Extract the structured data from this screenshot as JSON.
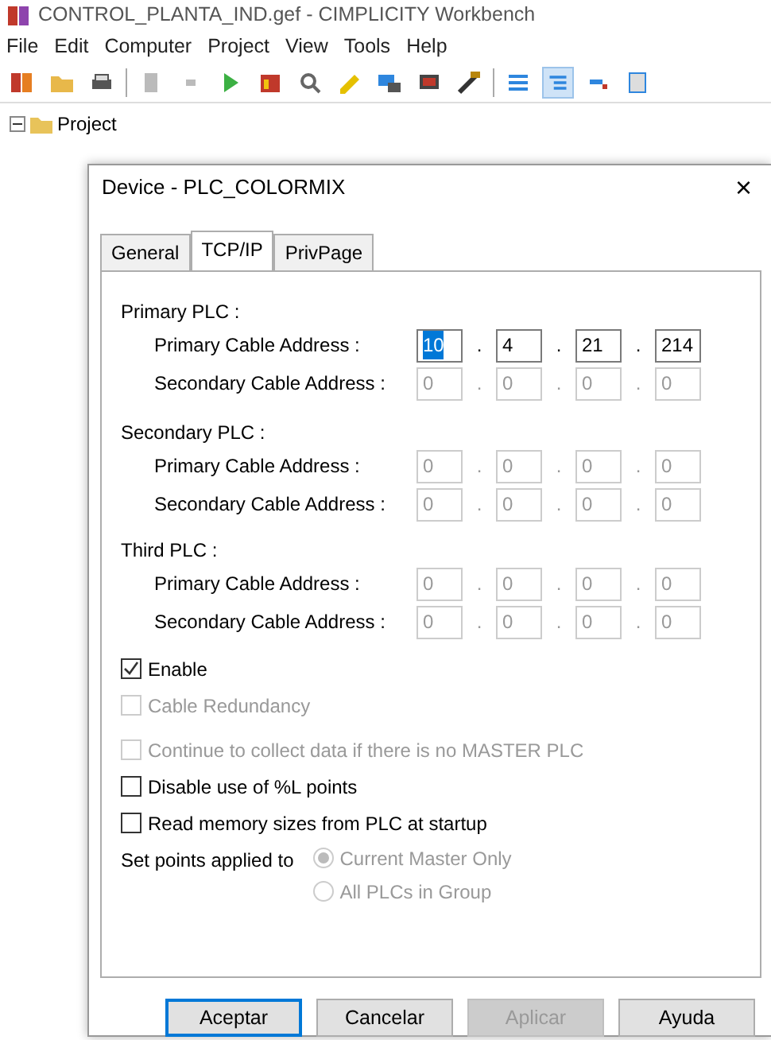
{
  "window": {
    "title": "CONTROL_PLANTA_IND.gef - CIMPLICITY Workbench"
  },
  "menu": [
    "File",
    "Edit",
    "Computer",
    "Project",
    "View",
    "Tools",
    "Help"
  ],
  "tree": {
    "label": "Project",
    "expanded": true
  },
  "dialog": {
    "title": "Device - PLC_COLORMIX",
    "close": "×",
    "separator": ".",
    "tabs": [
      {
        "label": "General",
        "selected": false
      },
      {
        "label": "TCP/IP",
        "selected": true
      },
      {
        "label": "PrivPage",
        "selected": false
      }
    ],
    "groups": [
      {
        "label": "Primary PLC :",
        "rows": [
          {
            "label": "Primary Cable Address :",
            "disabled": false,
            "octets": [
              {
                "value": "10",
                "selected": true
              },
              {
                "value": "4",
                "selected": false
              },
              {
                "value": "21",
                "selected": false
              },
              {
                "value": "214",
                "selected": false
              }
            ]
          },
          {
            "label": "Secondary Cable Address :",
            "disabled": true,
            "octets": [
              {
                "value": "0",
                "selected": false
              },
              {
                "value": "0",
                "selected": false
              },
              {
                "value": "0",
                "selected": false
              },
              {
                "value": "0",
                "selected": false
              }
            ]
          }
        ]
      },
      {
        "label": "Secondary PLC :",
        "rows": [
          {
            "label": "Primary Cable Address :",
            "disabled": true,
            "octets": [
              {
                "value": "0",
                "selected": false
              },
              {
                "value": "0",
                "selected": false
              },
              {
                "value": "0",
                "selected": false
              },
              {
                "value": "0",
                "selected": false
              }
            ]
          },
          {
            "label": "Secondary Cable Address :",
            "disabled": true,
            "octets": [
              {
                "value": "0",
                "selected": false
              },
              {
                "value": "0",
                "selected": false
              },
              {
                "value": "0",
                "selected": false
              },
              {
                "value": "0",
                "selected": false
              }
            ]
          }
        ]
      },
      {
        "label": "Third PLC :",
        "rows": [
          {
            "label": "Primary Cable Address :",
            "disabled": true,
            "octets": [
              {
                "value": "0",
                "selected": false
              },
              {
                "value": "0",
                "selected": false
              },
              {
                "value": "0",
                "selected": false
              },
              {
                "value": "0",
                "selected": false
              }
            ]
          },
          {
            "label": "Secondary Cable Address :",
            "disabled": true,
            "octets": [
              {
                "value": "0",
                "selected": false
              },
              {
                "value": "0",
                "selected": false
              },
              {
                "value": "0",
                "selected": false
              },
              {
                "value": "0",
                "selected": false
              }
            ]
          }
        ]
      }
    ],
    "options": [
      {
        "label": "Enable",
        "checked": true,
        "disabled": false
      },
      {
        "label": "Cable Redundancy",
        "checked": false,
        "disabled": true
      },
      {
        "label": "Continue to collect data if there is no MASTER PLC",
        "checked": false,
        "disabled": true
      },
      {
        "label": "Disable use of %L points",
        "checked": false,
        "disabled": false
      },
      {
        "label": "Read memory sizes from PLC at startup",
        "checked": false,
        "disabled": false
      }
    ],
    "set_points": {
      "label": "Set points applied to",
      "options": [
        {
          "label": "Current Master Only",
          "selected": true,
          "disabled": true
        },
        {
          "label": "All PLCs in Group",
          "selected": false,
          "disabled": true
        }
      ]
    },
    "buttons": [
      {
        "label": "Aceptar",
        "default": true,
        "disabled": false
      },
      {
        "label": "Cancelar",
        "default": false,
        "disabled": false
      },
      {
        "label": "Aplicar",
        "default": false,
        "disabled": true
      },
      {
        "label": "Ayuda",
        "default": false,
        "disabled": false
      }
    ]
  }
}
